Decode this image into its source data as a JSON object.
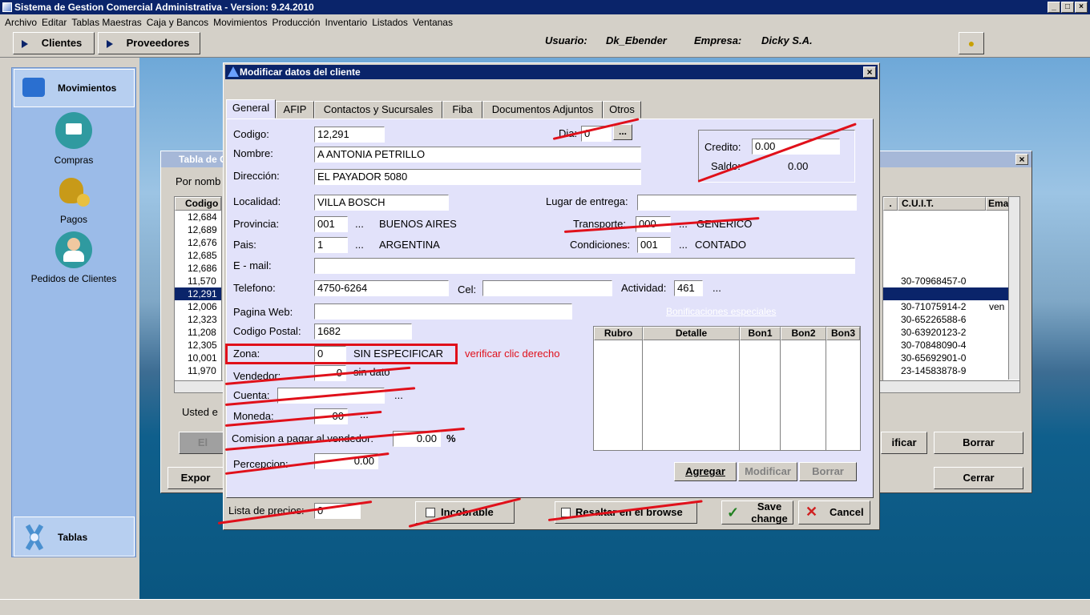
{
  "app": {
    "title": "Sistema de Gestion Comercial Administrativa - Version: 9.24.2010",
    "menu": [
      "Archivo",
      "Editar",
      "Tablas Maestras",
      "Caja y Bancos",
      "Movimientos",
      "Producción",
      "Inventario",
      "Listados",
      "Ventanas"
    ],
    "toolbar": {
      "clientes": "Clientes",
      "proveedores": "Proveedores",
      "usuario_label": "Usuario:",
      "usuario": "Dk_Ebender",
      "empresa_label": "Empresa:",
      "empresa": "Dicky S.A."
    }
  },
  "sidebar": {
    "section_movimientos": "Movimientos",
    "items": [
      {
        "label": "Compras"
      },
      {
        "label": "Pagos"
      },
      {
        "label": "Pedidos de Clientes"
      }
    ],
    "section_tablas": "Tablas"
  },
  "bgwin": {
    "title": "Tabla de C",
    "order": "Por nomb",
    "col_codigo": "Codigo",
    "col_cuit": "C.U.I.T.",
    "col_email": "Ema",
    "col_dot": ".",
    "codes": [
      "12,684",
      "12,689",
      "12,676",
      "12,685",
      "12,686",
      "11,570",
      "12,291",
      "12,006",
      "12,323",
      "11,208",
      "12,305",
      "10,001",
      "11,970"
    ],
    "cuits": [
      "",
      "",
      "",
      "",
      "",
      "30-70968457-0",
      "",
      "30-71075914-2",
      "30-65226588-6",
      "30-63920123-2",
      "30-70848090-4",
      "30-65692901-0",
      "23-14583878-9"
    ],
    "emails": [
      "",
      "",
      "",
      "",
      "",
      "",
      "",
      "ven",
      "",
      "",
      "",
      "",
      ""
    ],
    "usted": "Usted e",
    "btn_el": "El",
    "btn_modificar": "ificar",
    "btn_borrar": "Borrar",
    "btn_export": "Expor",
    "btn_cerrar": "Cerrar"
  },
  "dialog": {
    "title": "Modificar datos del cliente",
    "tabs": [
      "General",
      "AFIP",
      "Contactos y Sucursales",
      "Fiba",
      "Documentos Adjuntos",
      "Otros"
    ],
    "labels": {
      "codigo": "Codigo:",
      "dia": "Dia:",
      "nombre": "Nombre:",
      "direccion": "Dirección:",
      "credito": "Credito:",
      "saldo": "Saldo:",
      "localidad": "Localidad:",
      "lugar": "Lugar de entrega:",
      "provincia": "Provincia:",
      "transporte": "Transporte:",
      "pais": "Pais:",
      "condiciones": "Condiciones:",
      "email": "E - mail:",
      "telefono": "Telefono:",
      "cel": "Cel:",
      "actividad": "Actividad:",
      "web": "Pagina Web:",
      "bonif": "Bonificaciones especiales",
      "cp": "Codigo Postal:",
      "zona": "Zona:",
      "vendedor": "Vendedor:",
      "cuenta": "Cuenta:",
      "moneda": "Moneda:",
      "comision": "Comision a pagar al vendedor:",
      "percepcion": "Percepcion:",
      "lista": "Lista de precios:",
      "incobrable": "Incobrable",
      "resaltar": "Resaltar en el browse"
    },
    "values": {
      "codigo": "12,291",
      "dia": "0",
      "nombre": "A ANTONIA PETRILLO",
      "direccion": "EL PAYADOR 5080",
      "credito": "0.00",
      "saldo": "0.00",
      "localidad": "VILLA BOSCH",
      "lugar": "",
      "provincia_code": "001",
      "provincia": "BUENOS AIRES",
      "transporte_code": "000",
      "transporte": "GENERICO",
      "pais_code": "1",
      "pais": "ARGENTINA",
      "condiciones_code": "001",
      "condiciones": "CONTADO",
      "email": "",
      "telefono": "4750-6264",
      "cel": "",
      "actividad": "461",
      "web": "",
      "cp": "1682",
      "zona_code": "0",
      "zona": "SIN ESPECIFICAR",
      "vendedor_code": "0",
      "vendedor": "sin dato",
      "cuenta": "",
      "moneda": "00",
      "comision": "0.00",
      "percent": "%",
      "percepcion": "0.00",
      "lista": "0"
    },
    "ellipsis": "...",
    "annotation": "verificar clic derecho",
    "bon_headers": [
      "Rubro",
      "Detalle",
      "Bon1",
      "Bon2",
      "Bon3"
    ],
    "buttons": {
      "agregar": "Agregar",
      "modificar": "Modificar",
      "borrar": "Borrar",
      "save": "Save change",
      "cancel": "Cancel"
    }
  }
}
